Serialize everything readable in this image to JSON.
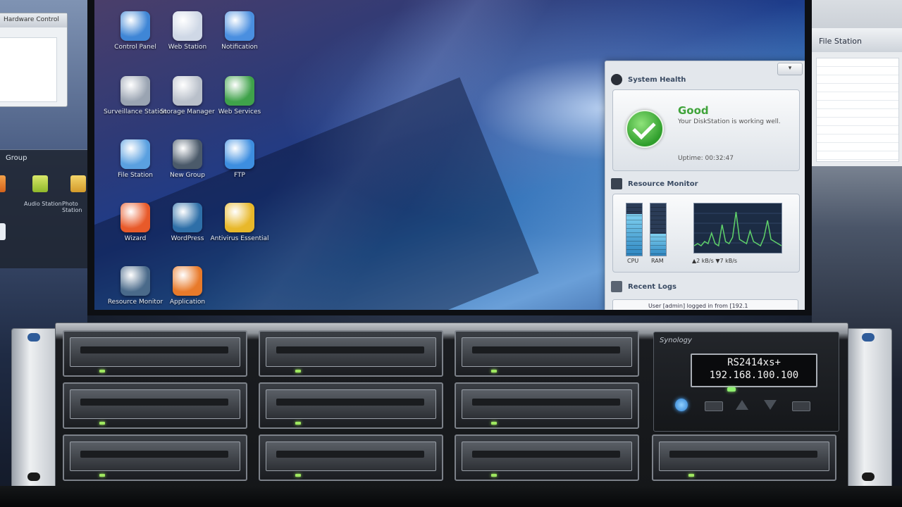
{
  "side_left": {
    "window_title": "Hardware Control",
    "group_title": "Group",
    "apps": [
      {
        "label": "Audio Station"
      },
      {
        "label": "Photo Station"
      }
    ]
  },
  "side_right": {
    "window_title": "File Station"
  },
  "desktop": {
    "icons": [
      {
        "label": "Control Panel",
        "icon": "control-panel-icon",
        "color": "#3f86d6"
      },
      {
        "label": "Web Station",
        "icon": "web-station-icon",
        "color": "#cfd8e6"
      },
      {
        "label": "Notification",
        "icon": "notification-icon",
        "color": "#4a8fe0"
      },
      {
        "label": "Surveillance Station",
        "icon": "surveillance-camera-icon",
        "color": "#9aa4b2"
      },
      {
        "label": "Storage Manager",
        "icon": "storage-manager-icon",
        "color": "#b9c0ca"
      },
      {
        "label": "Web Services",
        "icon": "globe-icon",
        "color": "#3fa24a"
      },
      {
        "label": "File Station",
        "icon": "file-station-icon",
        "color": "#5aa0e0"
      },
      {
        "label": "New Group",
        "icon": "new-group-icon",
        "color": "#4b5a6a"
      },
      {
        "label": "FTP",
        "icon": "ftp-icon",
        "color": "#3d8ee0"
      },
      {
        "label": "Wizard",
        "icon": "pie-chart-icon",
        "color": "#e85a2a"
      },
      {
        "label": "WordPress",
        "icon": "wordpress-icon",
        "color": "#2e6fa8"
      },
      {
        "label": "Antivirus Essential",
        "icon": "shield-icon",
        "color": "#e8b82a"
      },
      {
        "label": "Resource Monitor",
        "icon": "resource-monitor-icon",
        "color": "#4a6a8a"
      },
      {
        "label": "Application",
        "icon": "application-icon",
        "color": "#e87a2a"
      }
    ]
  },
  "widget": {
    "toggle": "▾",
    "system_health": {
      "title": "System Health",
      "status": "Good",
      "message": "Your DiskStation is working well.",
      "uptime": "Uptime: 00:32:47"
    },
    "resource_monitor": {
      "title": "Resource Monitor",
      "cpu_label": "CPU",
      "ram_label": "RAM",
      "cpu_fraction": 0.8,
      "ram_fraction": 0.42,
      "speed": "▲2 kB/s ▼7 kB/s",
      "graph_values": [
        2,
        3,
        2,
        4,
        3,
        8,
        3,
        2,
        12,
        4,
        3,
        6,
        18,
        5,
        4,
        3,
        9,
        4,
        3,
        2,
        6,
        14,
        5,
        4,
        3,
        2
      ],
      "y_max": 20,
      "graph_color": "#5fd16a"
    },
    "recent_logs": {
      "title": "Recent Logs",
      "entry": "User [admin] logged in from [192.1"
    }
  },
  "server": {
    "brand": "Synology",
    "lcd_line1": "RS2414xs+",
    "lcd_line2": "192.168.100.100",
    "led_color": "#9fe860",
    "bay_count": 11
  }
}
